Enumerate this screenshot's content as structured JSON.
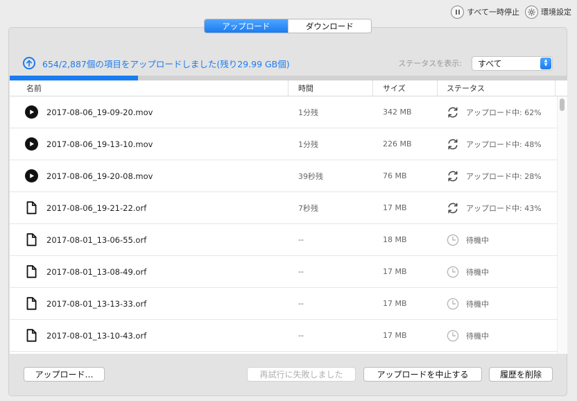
{
  "topbar": {
    "pause_all_label": "すべて一時停止",
    "settings_label": "環境設定"
  },
  "tabs": [
    {
      "label": "アップロード",
      "active": true
    },
    {
      "label": "ダウンロード",
      "active": false
    }
  ],
  "status": {
    "summary": "654/2,887個の項目をアップロードしました(残り29.99 GB個)",
    "filter_label": "ステータスを表示:",
    "filter_value": "すべて",
    "progress": 0.23
  },
  "table": {
    "columns": {
      "name": "名前",
      "time": "時間",
      "size": "サイズ",
      "status": "ステータス"
    },
    "rows": [
      {
        "icon": "play-icon",
        "name": "2017-08-06_19-09-20.mov",
        "time": "1分残",
        "size": "342 MB",
        "status_icon": "sync-icon",
        "status": "アップロード中: 62%"
      },
      {
        "icon": "play-icon",
        "name": "2017-08-06_19-13-10.mov",
        "time": "1分残",
        "size": "226 MB",
        "status_icon": "sync-icon",
        "status": "アップロード中: 48%"
      },
      {
        "icon": "play-icon",
        "name": "2017-08-06_19-20-08.mov",
        "time": "39秒残",
        "size": "76 MB",
        "status_icon": "sync-icon",
        "status": "アップロード中: 28%"
      },
      {
        "icon": "document-icon",
        "name": "2017-08-06_19-21-22.orf",
        "time": "7秒残",
        "size": "17 MB",
        "status_icon": "sync-icon",
        "status": "アップロード中: 43%"
      },
      {
        "icon": "document-icon",
        "name": "2017-08-01_13-06-55.orf",
        "time": "--",
        "size": "18 MB",
        "status_icon": "clock-icon",
        "status": "待機中"
      },
      {
        "icon": "document-icon",
        "name": "2017-08-01_13-08-49.orf",
        "time": "--",
        "size": "17 MB",
        "status_icon": "clock-icon",
        "status": "待機中"
      },
      {
        "icon": "document-icon",
        "name": "2017-08-01_13-13-33.orf",
        "time": "--",
        "size": "17 MB",
        "status_icon": "clock-icon",
        "status": "待機中"
      },
      {
        "icon": "document-icon",
        "name": "2017-08-01_13-10-43.orf",
        "time": "--",
        "size": "17 MB",
        "status_icon": "clock-icon",
        "status": "待機中"
      }
    ]
  },
  "buttons": {
    "upload": "アップロード…",
    "retry_failed": "再試行に失敗しました",
    "stop_upload": "アップロードを中止する",
    "clear_history": "履歴を削除"
  },
  "colors": {
    "accent": "#1a7cf2",
    "panel": "#e3e3e3"
  }
}
